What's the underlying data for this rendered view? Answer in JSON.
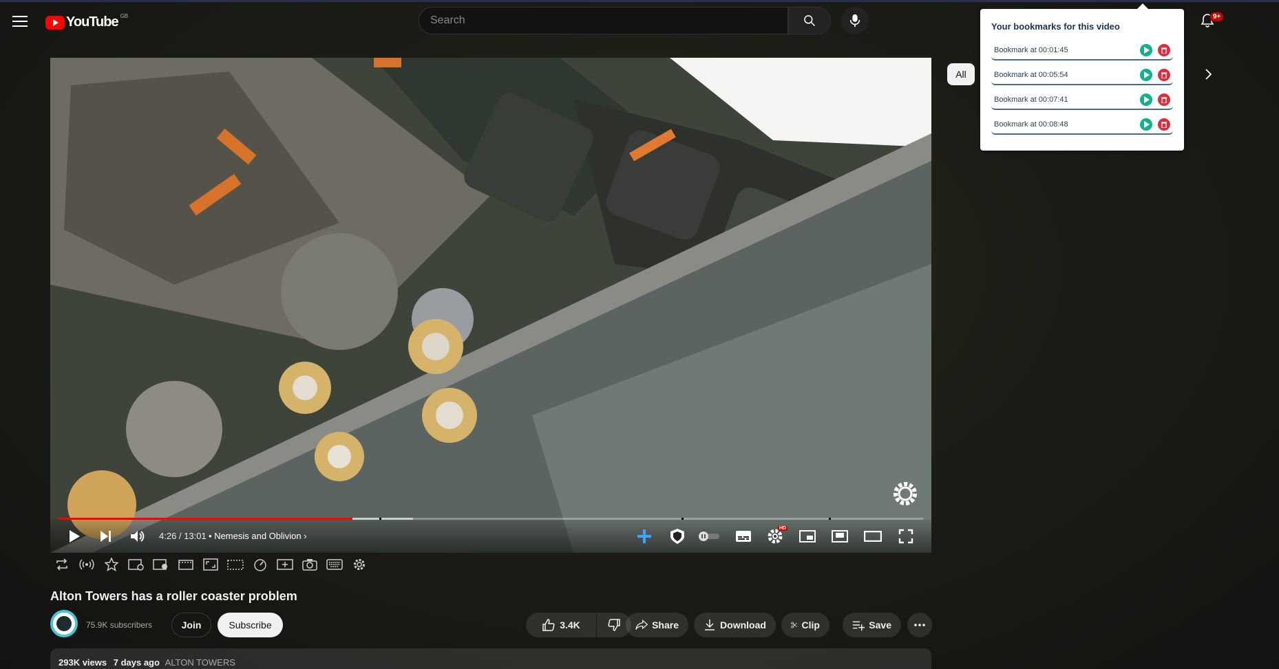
{
  "header": {
    "logo_text": "YouTube",
    "country_code": "GB",
    "search_placeholder": "Search",
    "notification_badge": "9+"
  },
  "player": {
    "time_display": "4:26 / 13:01",
    "chapter_separator": "•",
    "chapter": "Nemesis and Oblivion",
    "progress_played_fraction": 0.34,
    "progress_buffered_fraction": 0.41,
    "hd_badge": "HD"
  },
  "video": {
    "title": "Alton Towers has a roller coaster problem",
    "subscribers": "75.9K subscribers",
    "join_label": "Join",
    "subscribe_label": "Subscribe",
    "likes": "3.4K",
    "share_label": "Share",
    "download_label": "Download",
    "clip_label": "Clip",
    "save_label": "Save",
    "views": "293K views",
    "age": "7 days ago",
    "tag": "ALTON TOWERS"
  },
  "chips": {
    "all_label": "All"
  },
  "bookmarks": {
    "title": "Your bookmarks for this video",
    "items": [
      {
        "label": "Bookmark at 00:01:45"
      },
      {
        "label": "Bookmark at 00:05:54"
      },
      {
        "label": "Bookmark at 00:07:41"
      },
      {
        "label": "Bookmark at 00:08:48"
      }
    ]
  },
  "colors": {
    "brand_red": "#ff0000",
    "progress_red": "#ff0000",
    "bookmark_play": "#14b08a",
    "bookmark_delete": "#d9303f",
    "enhancer_blue": "#3ea6ff"
  }
}
